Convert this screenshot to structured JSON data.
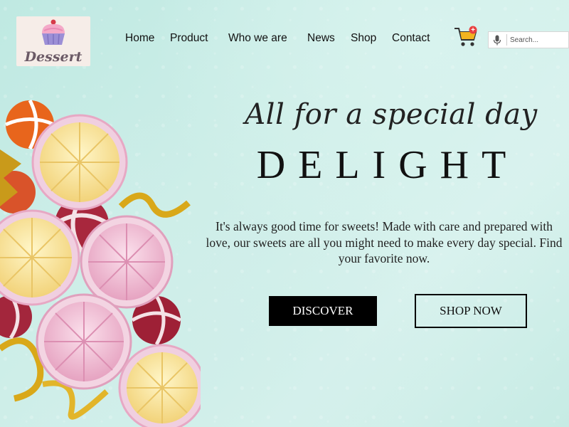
{
  "brand": {
    "logo_text": "Dessert"
  },
  "nav": {
    "items": [
      "Home",
      "Product",
      "Who we are",
      "News",
      "Shop",
      "Contact"
    ]
  },
  "cart": {
    "badge": "+"
  },
  "search": {
    "placeholder": "Search..."
  },
  "hero": {
    "tagline": "All for a special day",
    "headline": "DELIGHT",
    "description": "It's always good time for sweets! Made with care and prepared with love, our sweets are all you might need to make every day special. Find your favorite now.",
    "discover_label": "DISCOVER",
    "shop_label": "SHOP NOW"
  },
  "colors": {
    "background": "#cdeee8",
    "button_dark": "#000000",
    "cart_yellow": "#f2b420",
    "badge_red": "#e94040"
  }
}
